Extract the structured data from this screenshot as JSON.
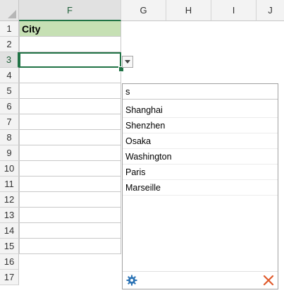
{
  "columns": [
    "F",
    "G",
    "H",
    "I",
    "J"
  ],
  "rows": [
    "1",
    "2",
    "3",
    "4",
    "5",
    "6",
    "7",
    "8",
    "9",
    "10",
    "11",
    "12",
    "13",
    "14",
    "15",
    "16",
    "17"
  ],
  "sheet": {
    "f1_value": "City"
  },
  "panel": {
    "search_value": "s",
    "items": [
      "Shanghai",
      "Shenzhen",
      "Osaka",
      "Washington",
      "Paris",
      "Marseille"
    ]
  },
  "icons": {
    "dropdown": "dropdown-arrow-icon",
    "settings": "gear-icon",
    "close": "close-icon"
  },
  "colors": {
    "header_fill": "#c6e0b4",
    "selection": "#217346",
    "gear": "#2e75b6",
    "close": "#e05a2b"
  }
}
